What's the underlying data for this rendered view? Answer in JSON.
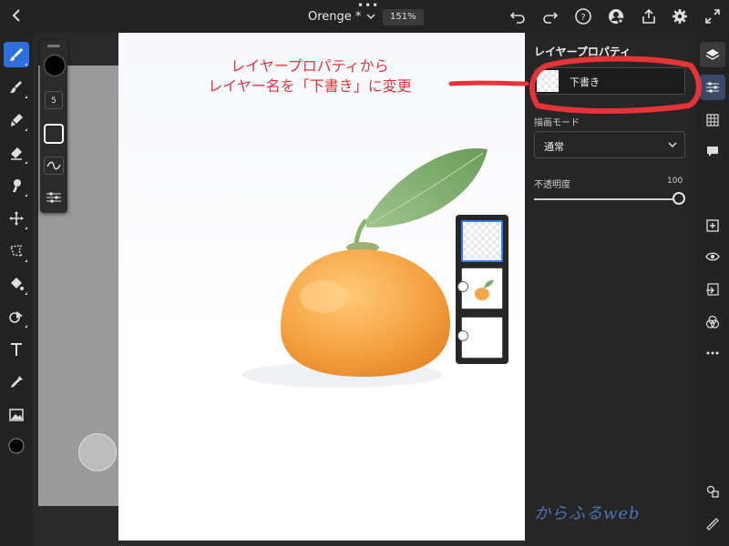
{
  "topbar": {
    "doc_title": "Orenge *",
    "zoom": "151%",
    "icons": [
      "back-icon",
      "more-dots-icon",
      "caret-down-icon",
      "undo-icon",
      "redo-icon",
      "help-icon",
      "add-user-icon",
      "share-icon",
      "settings-icon",
      "fullscreen-icon"
    ]
  },
  "left_tools": [
    "brush-icon",
    "paint-icon",
    "eraser-icon",
    "smudge-icon",
    "move-icon",
    "lasso-icon",
    "fill-icon",
    "shape-icon",
    "text-icon",
    "eyedropper-icon",
    "image-icon",
    "color-icon"
  ],
  "brush_panel": {
    "size": "5"
  },
  "layer_properties": {
    "title": "レイヤープロパティ",
    "layer_name": "下書き",
    "blend_mode_label": "描画モード",
    "blend_mode_value": "通常",
    "opacity_label": "不透明度",
    "opacity_value": "100",
    "opacity_fraction": 1.0
  },
  "right_icons": [
    "layers-icon",
    "properties-icon",
    "grid-icon",
    "comment-icon",
    "add-layer-icon",
    "visibility-icon",
    "import-icon",
    "blend-icon",
    "more-icon",
    "mask-icon",
    "ruler-icon"
  ],
  "annotation": {
    "line1": "レイヤープロパティから",
    "line2": "レイヤー名を「下書き」に変更",
    "color": "#e63339"
  },
  "watermark": "からふるweb",
  "colors": {
    "accent": "#2d6fdd",
    "selected_layer": "#3c7bf0",
    "orange": "#f4a84b",
    "leaf": "#7fae6c"
  }
}
